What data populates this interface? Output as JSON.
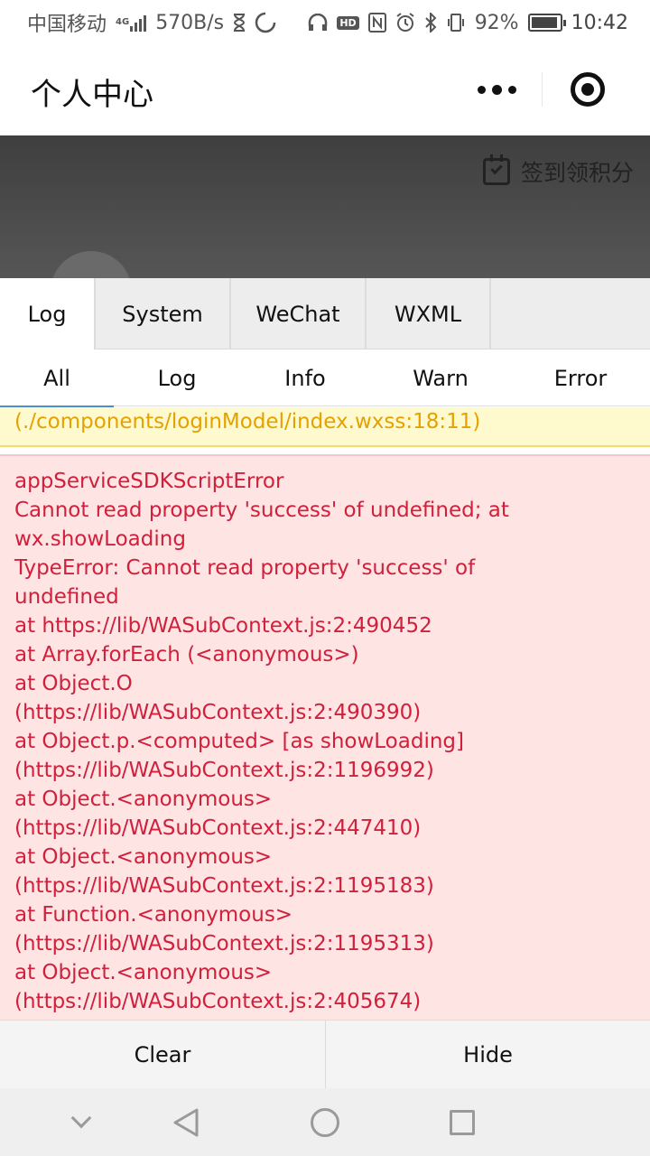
{
  "status_bar": {
    "carrier": "中国移动",
    "network_type": "4G",
    "net_speed": "570B/s",
    "hd_badge": "HD",
    "battery": "92%",
    "battery_level": 0.92,
    "time": "10:42"
  },
  "navbar": {
    "title": "个人中心"
  },
  "page": {
    "checkin_label": "签到领积分"
  },
  "vconsole": {
    "tabs": [
      {
        "label": "Log"
      },
      {
        "label": "System"
      },
      {
        "label": "WeChat"
      },
      {
        "label": "WXML"
      }
    ],
    "subtabs": [
      {
        "label": "All"
      },
      {
        "label": "Log"
      },
      {
        "label": "Info"
      },
      {
        "label": "Warn"
      },
      {
        "label": "Error"
      }
    ],
    "warn_text": "(./components/loginModel/index.wxss:18:11)",
    "error_lines": [
      "appServiceSDKScriptError",
      "Cannot read property 'success' of undefined; at",
      "wx.showLoading",
      "TypeError: Cannot read property 'success' of",
      "undefined",
      "at https://lib/WASubContext.js:2:490452",
      "at Array.forEach (<anonymous>)",
      "at Object.O",
      "(https://lib/WASubContext.js:2:490390)",
      "at Object.p.<computed> [as showLoading]",
      "(https://lib/WASubContext.js:2:1196992)",
      "at Object.<anonymous>",
      "(https://lib/WASubContext.js:2:447410)",
      "at Object.<anonymous>",
      "(https://lib/WASubContext.js:2:1195183)",
      "at Function.<anonymous>",
      "(https://lib/WASubContext.js:2:1195313)",
      "at Object.<anonymous>",
      "(https://lib/WASubContext.js:2:405674)"
    ],
    "buttons": {
      "clear": "Clear",
      "hide": "Hide"
    }
  },
  "colors": {
    "warn_bg": "#fffacd",
    "warn_text": "#e4a100",
    "error_bg": "#ffe4e4",
    "error_text": "#d0203b",
    "tab_bg": "#ededed"
  }
}
